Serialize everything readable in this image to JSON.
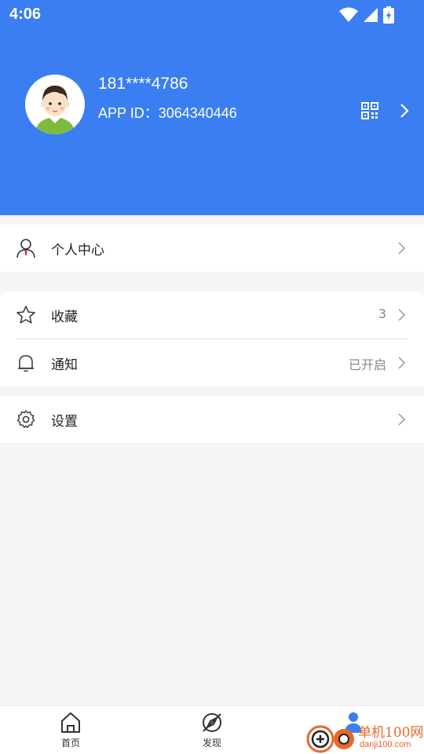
{
  "status_bar": {
    "time": "4:06"
  },
  "profile": {
    "phone": "181****4786",
    "app_id_label": "APP ID：",
    "app_id": "3064340446"
  },
  "menu": {
    "personal_center": {
      "label": "个人中心"
    },
    "favorites": {
      "label": "收藏",
      "value": "3"
    },
    "notifications": {
      "label": "通知",
      "value": "已开启"
    },
    "settings": {
      "label": "设置"
    }
  },
  "bottom_nav": {
    "home": "首页",
    "discover": "发现"
  },
  "watermark": {
    "text": "单机100网",
    "sub": "danji100.com"
  },
  "colors": {
    "header": "#3a7ef1",
    "background": "#f5f5f5",
    "watermark": "#e8672b"
  }
}
